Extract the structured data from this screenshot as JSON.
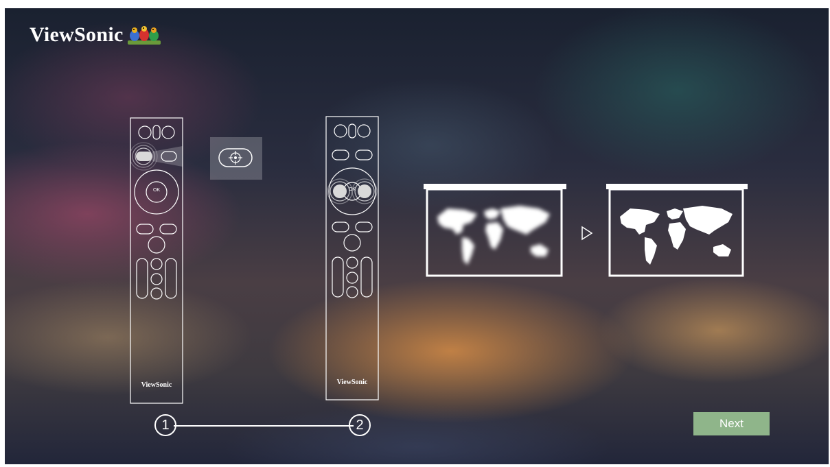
{
  "brand": {
    "name": "ViewSonic",
    "logo_icon": "birds-logo-icon"
  },
  "remote_1": {
    "ok_label": "OK",
    "brand_label": "ViewSonic",
    "focus_button_icon": "focus-target-icon"
  },
  "remote_2": {
    "ok_label": "OK",
    "brand_label": "ViewSonic"
  },
  "steps": [
    {
      "number": "1"
    },
    {
      "number": "2"
    }
  ],
  "screens": {
    "blurred_icon": "world-map-blurred-icon",
    "sharp_icon": "world-map-sharp-icon",
    "arrow_icon": "arrow-right-icon"
  },
  "actions": {
    "next_label": "Next"
  },
  "colors": {
    "next_button": "#8fb58a",
    "outline": "#ffffff"
  }
}
